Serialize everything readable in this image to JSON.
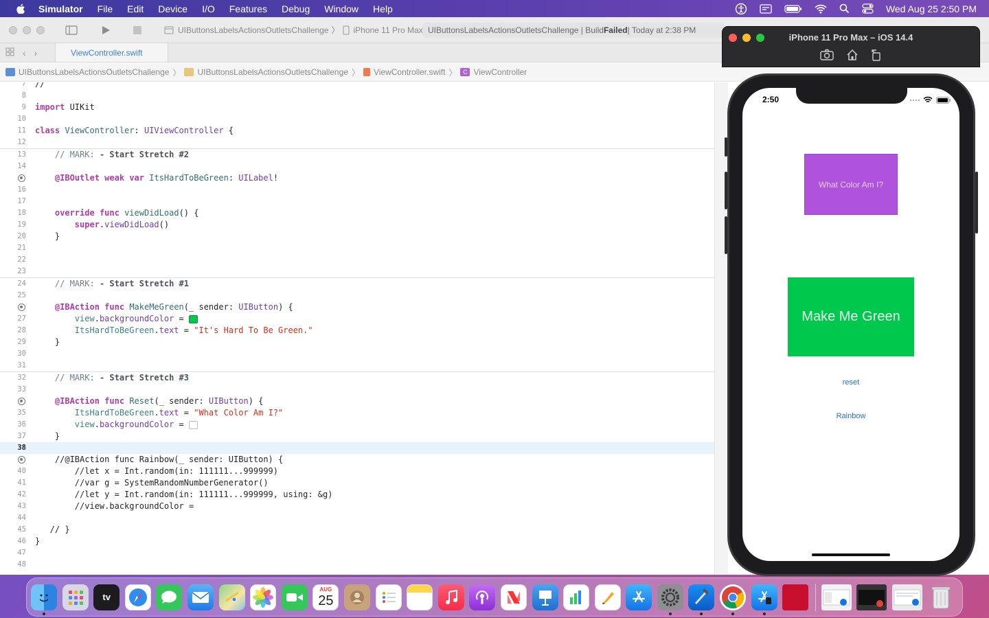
{
  "menubar": {
    "app_name": "Simulator",
    "items": [
      "File",
      "Edit",
      "Device",
      "I/O",
      "Features",
      "Debug",
      "Window",
      "Help"
    ],
    "datetime": "Wed Aug 25  2:50 PM"
  },
  "toolbar": {
    "scheme": "UIButtonsLabelsActionsOutletsChallenge",
    "device": "iPhone 11 Pro Max",
    "status_project": "UIButtonsLabelsActionsOutletsChallenge | Build ",
    "status_result": "Failed",
    "status_time": " | Today at 2:38 PM"
  },
  "tab": {
    "label": "ViewController.swift"
  },
  "jumpbar": {
    "crumbs": [
      "UIButtonsLabelsActionsOutletsChallenge",
      "UIButtonsLabelsActionsOutletsChallenge",
      "ViewController.swift",
      "ViewController"
    ]
  },
  "editor": {
    "current_line": 38
  },
  "simulator": {
    "title": "iPhone 11 Pro Max – iOS 14.4",
    "status_time": "2:50",
    "label_text": "What Color Am I?",
    "green_button": "Make Me Green",
    "reset_button": "reset",
    "rainbow_button": "Rainbow",
    "label_color": "#af52de",
    "green_color": "#00c84c",
    "link_color": "#1f6fd6"
  },
  "dock": {
    "apps": [
      "Finder",
      "Launchpad",
      "TV",
      "Safari",
      "Messages",
      "Mail",
      "Maps",
      "Photos",
      "FaceTime",
      "Calendar",
      "Contacts",
      "Reminders",
      "Notes",
      "Music",
      "Podcasts",
      "News",
      "Keynote",
      "Numbers",
      "Pages",
      "App Store",
      "System Preferences",
      "Xcode",
      "Chrome",
      "Simulator",
      "Parallels"
    ],
    "calendar_month": "AUG",
    "calendar_day": "25",
    "tv_label": "tv"
  }
}
